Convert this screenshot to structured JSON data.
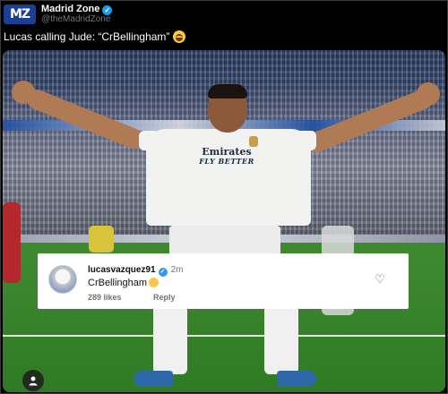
{
  "tweet": {
    "author": {
      "avatar_text": "MZ",
      "display_name": "Madrid Zone",
      "handle": "@theMadridZone",
      "verified": true
    },
    "text": "Lucas calling Jude: “CrBellingham”",
    "text_emoji": "laughing-face"
  },
  "photo": {
    "jersey_sponsor": "Emirates",
    "jersey_sponsor_sub": "FLY BETTER",
    "comment": {
      "username": "lucasvazquez91",
      "verified": true,
      "time": "2m",
      "text": "CrBellingham",
      "text_emoji": "laughing-face",
      "likes": "289 likes",
      "reply": "Reply"
    }
  },
  "colors": {
    "background": "#000000",
    "avatar_bg": "#1a3f95",
    "verified_badge": "#1d9bf0",
    "handle_text": "#71767b",
    "comment_card": "#ffffff"
  }
}
